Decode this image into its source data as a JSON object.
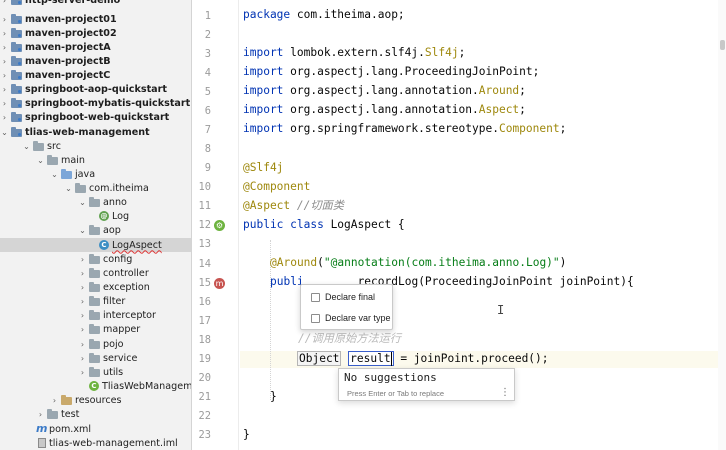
{
  "project_tree": {
    "modules": [
      "http-server-demo",
      "maven-project01",
      "maven-project02",
      "maven-projectA",
      "maven-projectB",
      "maven-projectC",
      "springboot-aop-quickstart",
      "springboot-mybatis-quickstart",
      "springboot-web-quickstart",
      "tlias-web-management"
    ],
    "src": "src",
    "main": "main",
    "java": "java",
    "package": "com.itheima",
    "anno": "anno",
    "log": "Log",
    "aop": "aop",
    "log_aspect": "LogAspect",
    "packages": [
      "config",
      "controller",
      "exception",
      "filter",
      "interceptor",
      "mapper",
      "pojo",
      "service",
      "utils"
    ],
    "app_class": "TliasWebManagement",
    "resources": "resources",
    "test": "test",
    "pom": "pom.xml",
    "iml": "tlias-web-management.iml"
  },
  "editor": {
    "line_numbers": [
      "1",
      "2",
      "3",
      "4",
      "5",
      "6",
      "7",
      "8",
      "9",
      "10",
      "11",
      "12",
      "13",
      "14",
      "15",
      "16",
      "17",
      "18",
      "19",
      "20",
      "21",
      "22",
      "23"
    ],
    "code": {
      "l1_kw": "package",
      "l1_rest": " com.itheima.aop;",
      "l3_kw": "import",
      "l3_a": " lombok.extern.slf4j.",
      "l3_b": "Slf4j",
      "l3_c": ";",
      "l4_kw": "import",
      "l4_a": " org.aspectj.lang.ProceedingJoinPoint;",
      "l5_kw": "import",
      "l5_a": " org.aspectj.lang.annotation.",
      "l5_b": "Around",
      "l5_c": ";",
      "l6_kw": "import",
      "l6_a": " org.aspectj.lang.annotation.",
      "l6_b": "Aspect",
      "l6_c": ";",
      "l7_kw": "import",
      "l7_a": " org.springframework.stereotype.",
      "l7_b": "Component",
      "l7_c": ";",
      "l9": "@Slf4j",
      "l10": "@Component",
      "l11_an": "@Aspect",
      "l11_cmt": " //切面类",
      "l12_kw": "public class",
      "l12_rest": " LogAspect {",
      "l14_an": "@Around",
      "l14_p1": "(",
      "l14_str": "\"@annotation(com.itheima.anno.Log)\"",
      "l14_p2": ")",
      "l15_kw": "publi",
      "l15_rest": "        recordLog(ProceedingJoinPoint joinPoint){",
      "l18_cmt": "//调用原始方法运行",
      "l19_type": "Object",
      "l19_var": "result",
      "l19_rest": " = joinPoint.proceed();",
      "l21": "}",
      "l23": "}"
    }
  },
  "declare_popup": {
    "options": [
      "Declare final",
      "Declare var type"
    ]
  },
  "suggestions": {
    "message": "No suggestions",
    "hint": "Press Enter or Tab to replace",
    "more": "⋮"
  }
}
